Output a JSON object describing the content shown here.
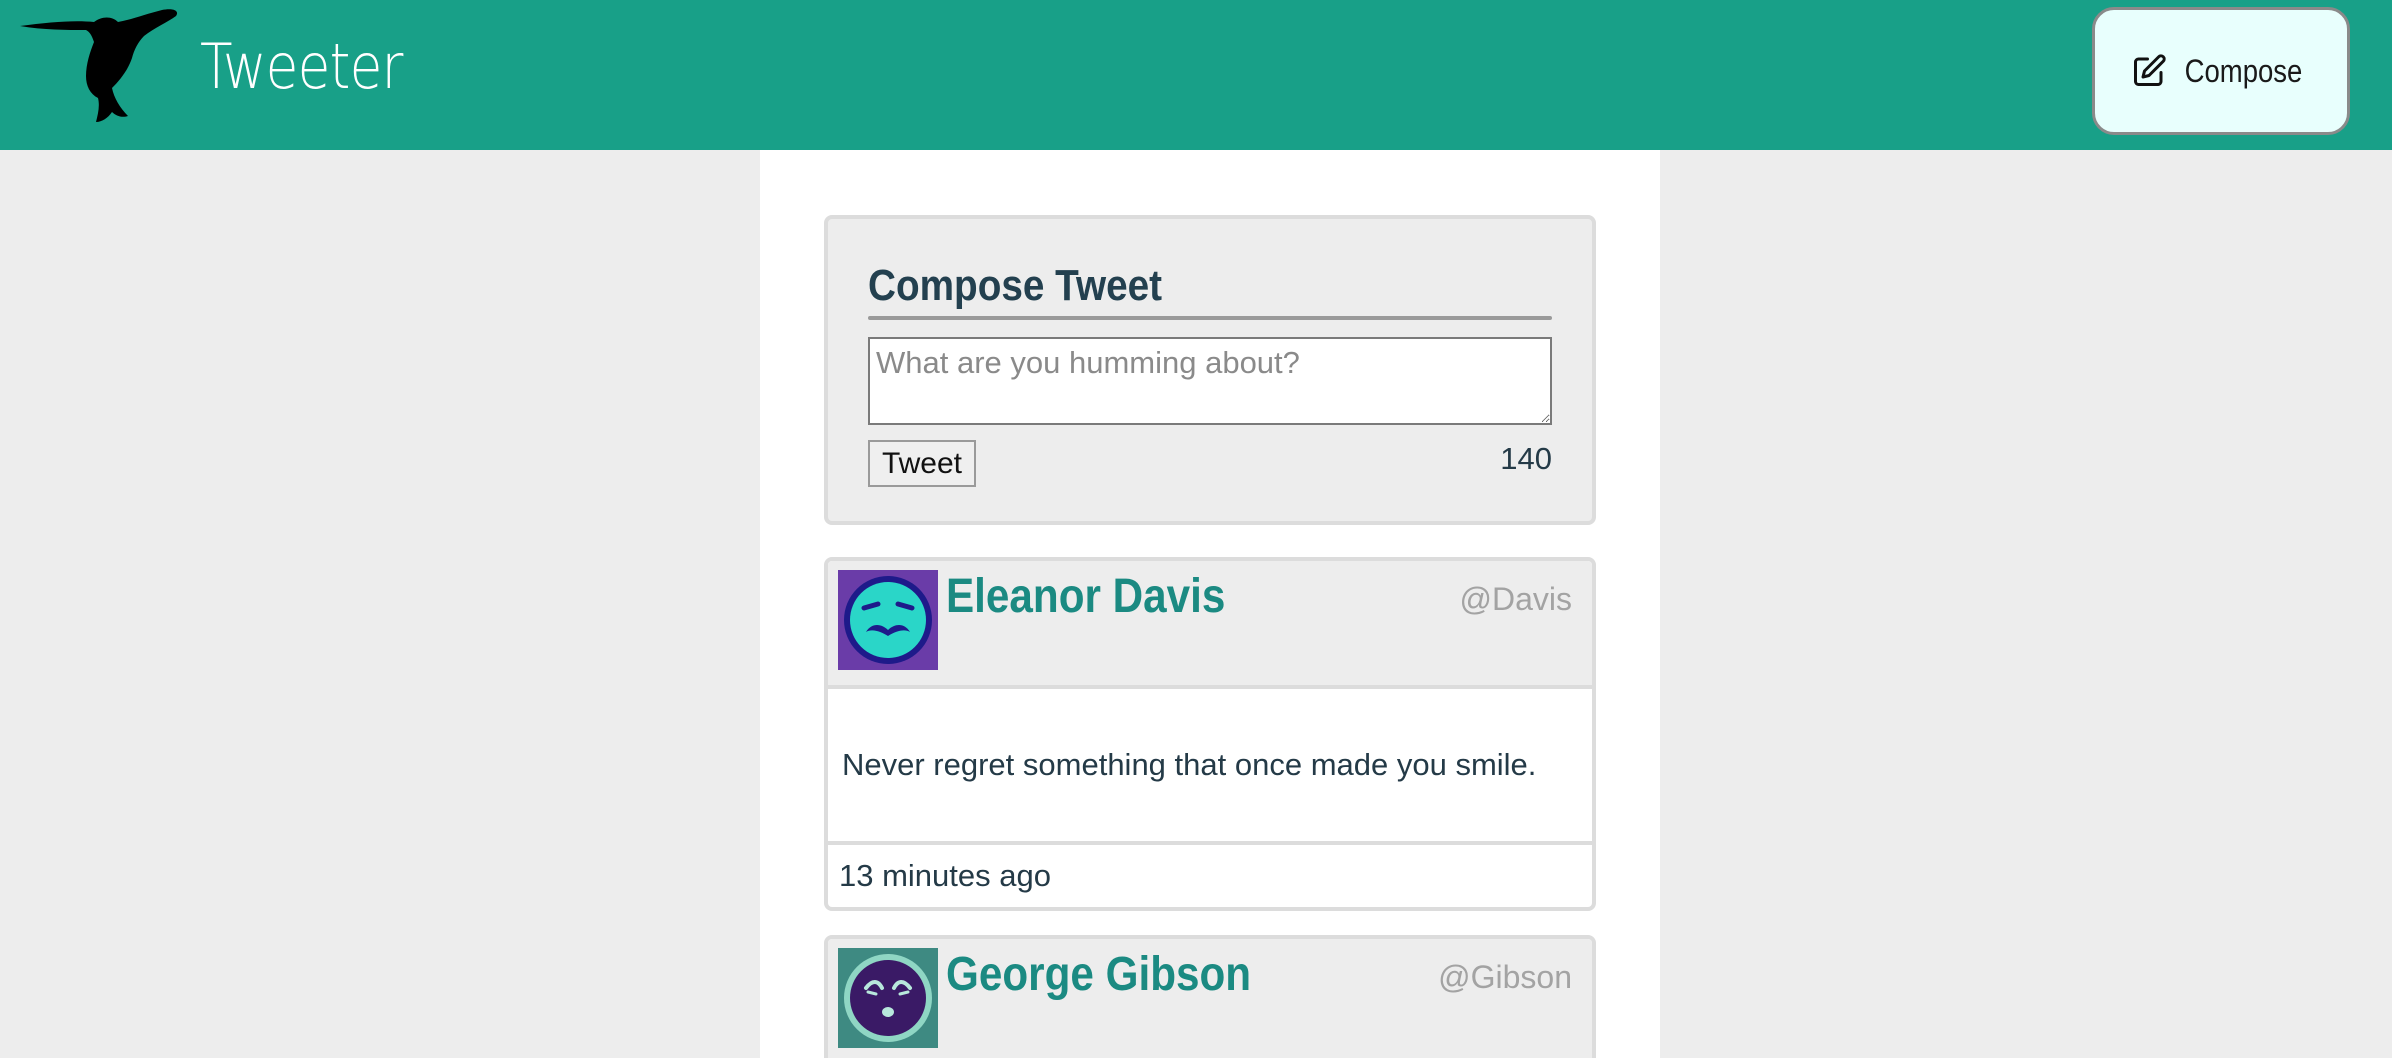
{
  "nav": {
    "brand": "Tweeter",
    "compose_label": "Compose"
  },
  "composer": {
    "title": "Compose Tweet",
    "placeholder": "What are you humming about?",
    "submit_label": "Tweet",
    "char_count": "140"
  },
  "tweets": [
    {
      "name": "Eleanor Davis",
      "handle": "@Davis",
      "text": "Never regret something that once made you smile.",
      "time": "13 minutes ago",
      "avatar_bg": "#6a3ca8",
      "avatar_face": "#2ad6c8"
    },
    {
      "name": "George Gibson",
      "handle": "@Gibson",
      "text": "",
      "time": "",
      "avatar_bg": "#3e8a82",
      "avatar_face": "#3a1a66"
    }
  ],
  "colors": {
    "nav_bg": "#18a088",
    "accent_name": "#1b8a82",
    "page_bg": "#ededed"
  },
  "icons": {
    "logo": "hummingbird-icon",
    "compose": "edit-icon"
  }
}
